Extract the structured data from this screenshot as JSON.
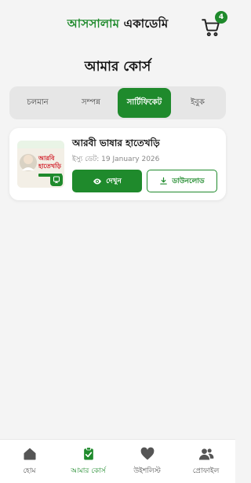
{
  "header": {
    "logo_part1": "আসসালাম",
    "logo_part2": "একাডেমি",
    "cart_count": "4"
  },
  "page_title": "আমার কোর্স",
  "tabs": [
    {
      "label": "চলমান",
      "active": false
    },
    {
      "label": "সম্পন্ন",
      "active": false
    },
    {
      "label": "সার্টিফিকেট",
      "active": true
    },
    {
      "label": "ইবুক",
      "active": false
    }
  ],
  "certificate": {
    "title": "আরবী ভাষার হাতেখড়ি",
    "issue_date": "ইস্যু ডেট: 19 January 2026",
    "view_label": "দেখুন",
    "download_label": "ডাউনলোড",
    "thumbnail_text": "আরবি হাতেখড়ি"
  },
  "bottom_nav": [
    {
      "label": "হোম",
      "icon": "home-icon",
      "active": false
    },
    {
      "label": "আমার কোর্স",
      "icon": "clipboard-icon",
      "active": true
    },
    {
      "label": "উইশলিস্ট",
      "icon": "heart-icon",
      "active": false
    },
    {
      "label": "প্রোফাইল",
      "icon": "profile-icon",
      "active": false
    }
  ],
  "colors": {
    "brand_green": "#1f8a2c",
    "background": "#f4f4f4"
  }
}
